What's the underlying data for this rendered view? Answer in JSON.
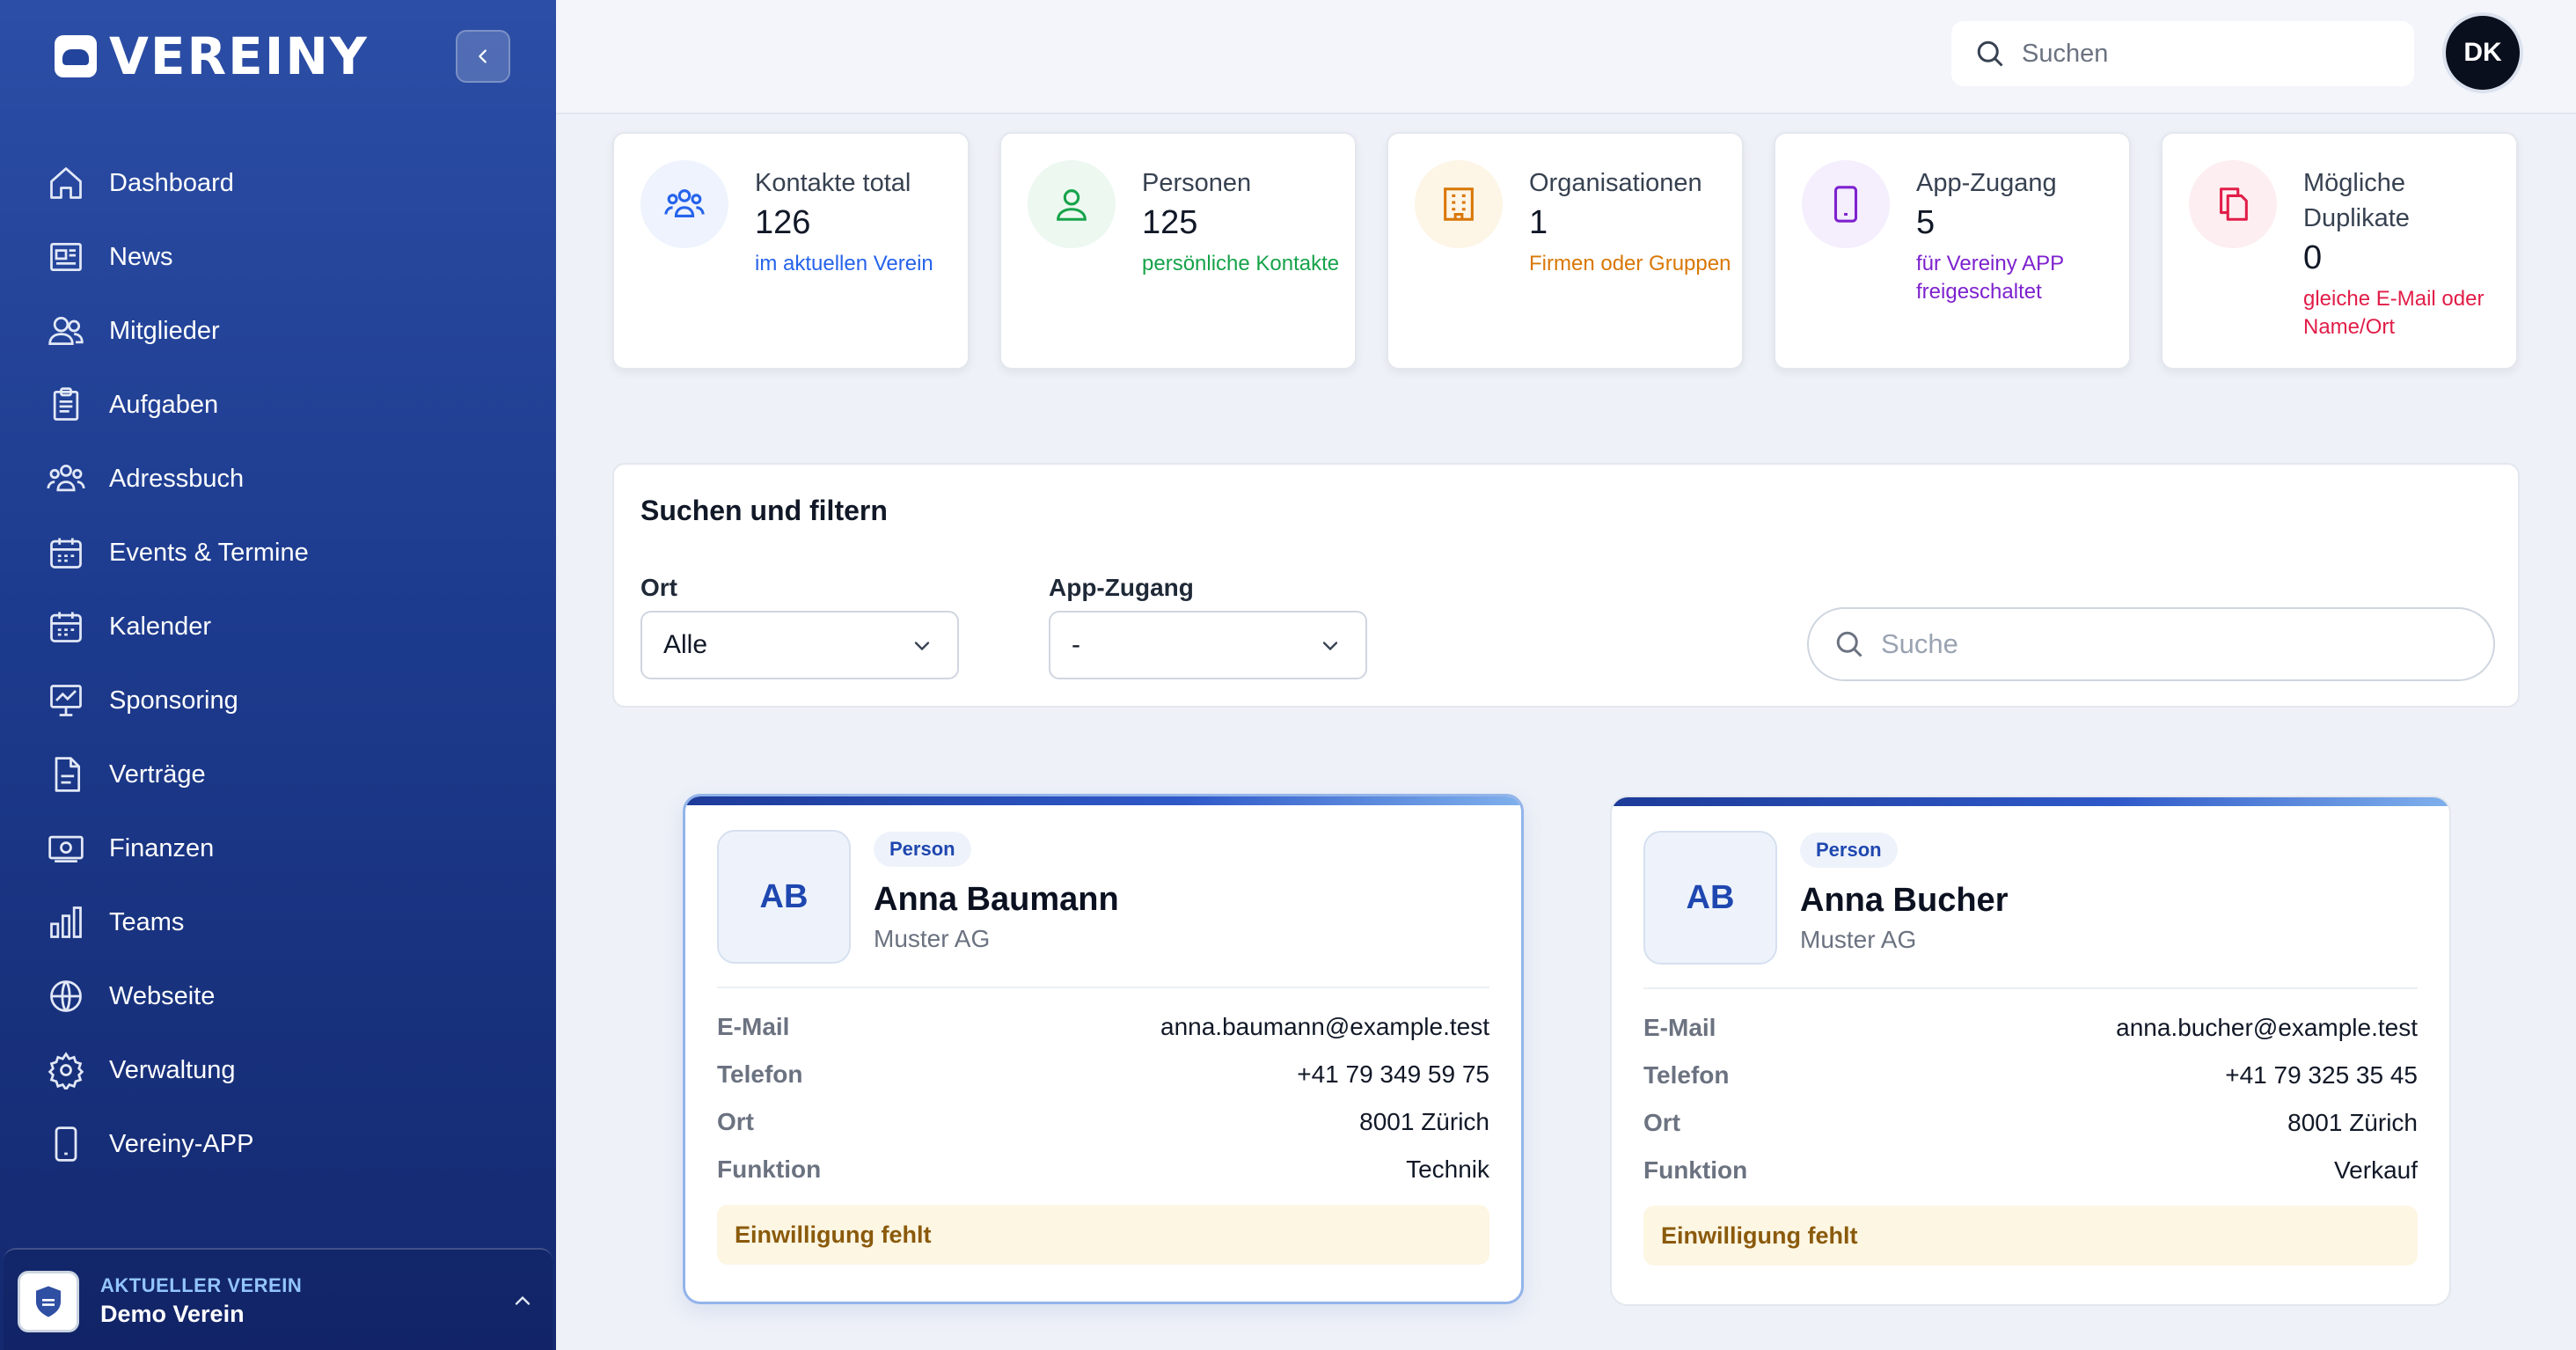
{
  "app": {
    "logo_text": "VEREINY"
  },
  "sidebar": {
    "items": [
      {
        "label": "Dashboard",
        "icon": "home-icon"
      },
      {
        "label": "News",
        "icon": "newspaper-icon"
      },
      {
        "label": "Mitglieder",
        "icon": "users-icon"
      },
      {
        "label": "Aufgaben",
        "icon": "clipboard-icon"
      },
      {
        "label": "Adressbuch",
        "icon": "group-icon"
      },
      {
        "label": "Events & Termine",
        "icon": "calendar-icon"
      },
      {
        "label": "Kalender",
        "icon": "calendar-icon"
      },
      {
        "label": "Sponsoring",
        "icon": "presentation-icon"
      },
      {
        "label": "Verträge",
        "icon": "document-icon"
      },
      {
        "label": "Finanzen",
        "icon": "banknote-icon"
      },
      {
        "label": "Teams",
        "icon": "bar-chart-icon"
      },
      {
        "label": "Webseite",
        "icon": "globe-icon"
      },
      {
        "label": "Verwaltung",
        "icon": "gear-icon"
      },
      {
        "label": "Vereiny-APP",
        "icon": "phone-icon"
      }
    ],
    "club": {
      "caption": "AKTUELLER VEREIN",
      "name": "Demo Verein"
    }
  },
  "topbar": {
    "search_placeholder": "Suchen",
    "avatar_initials": "DK"
  },
  "stats": [
    {
      "title": "Kontakte total",
      "value": "126",
      "sub": "im aktuellen Verein",
      "color": "#2563eb",
      "bg": "#eef3fd",
      "icon": "group-icon"
    },
    {
      "title": "Personen",
      "value": "125",
      "sub": "persönliche Kontakte",
      "color": "#16a34a",
      "bg": "#ecf8f0",
      "icon": "user-icon"
    },
    {
      "title": "Organisationen",
      "value": "1",
      "sub": "Firmen oder Gruppen",
      "color": "#d97706",
      "bg": "#fdf5e6",
      "icon": "building-icon"
    },
    {
      "title": "App-Zugang",
      "value": "5",
      "sub": "für Vereiny APP freigeschaltet",
      "color": "#7e22ce",
      "bg": "#f4eefd",
      "icon": "phone-icon"
    },
    {
      "title": "Mögliche Duplikate",
      "value": "0",
      "sub": "gleiche E-Mail oder Name/Ort",
      "color": "#e11d48",
      "bg": "#fdeef1",
      "icon": "copy-icon"
    }
  ],
  "filter": {
    "title": "Suchen und filtern",
    "ort_label": "Ort",
    "ort_value": "Alle",
    "app_label": "App-Zugang",
    "app_value": "-",
    "search_placeholder": "Suche"
  },
  "contacts": [
    {
      "initials": "AB",
      "type": "Person",
      "name": "Anna Baumann",
      "company": "Muster AG",
      "email_label": "E-Mail",
      "email": "anna.baumann@example.test",
      "phone_label": "Telefon",
      "phone": "+41 79 349 59 75",
      "ort_label": "Ort",
      "ort": "8001 Zürich",
      "function_label": "Funktion",
      "function": "Technik",
      "consent": "Einwilligung fehlt"
    },
    {
      "initials": "AB",
      "type": "Person",
      "name": "Anna Bucher",
      "company": "Muster AG",
      "email_label": "E-Mail",
      "email": "anna.bucher@example.test",
      "phone_label": "Telefon",
      "phone": "+41 79 325 35 45",
      "ort_label": "Ort",
      "ort": "8001 Zürich",
      "function_label": "Funktion",
      "function": "Verkauf",
      "consent": "Einwilligung fehlt"
    }
  ]
}
